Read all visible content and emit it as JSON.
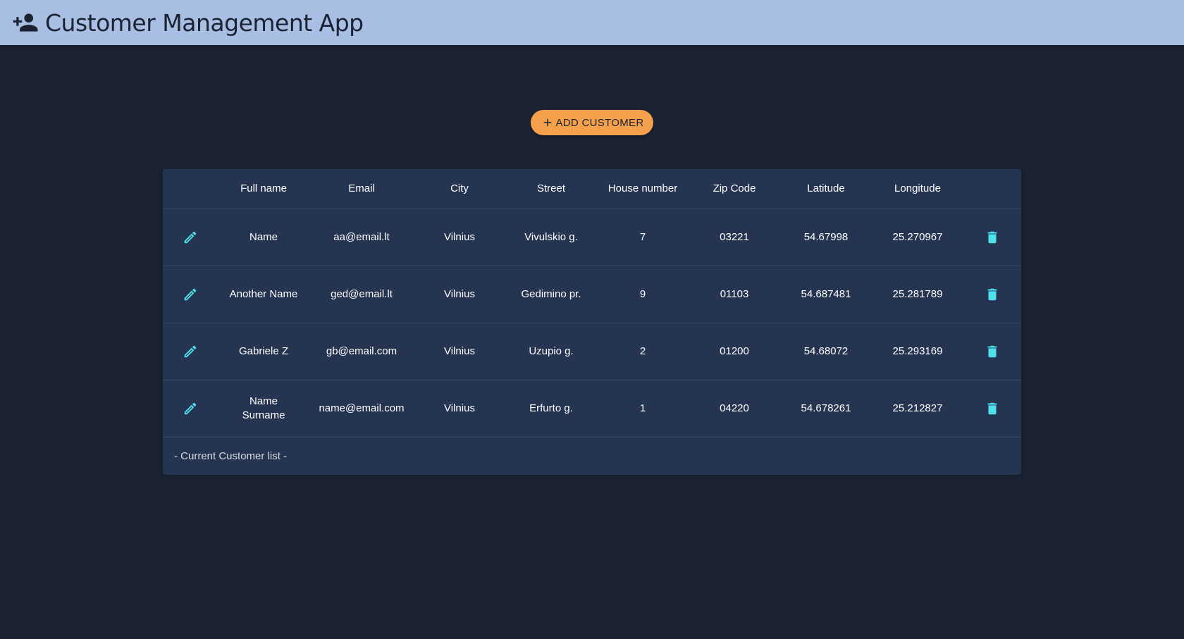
{
  "app": {
    "title": "Customer Management App",
    "logo_icon": "person-add-icon"
  },
  "colors": {
    "appbar": "#a8bee3",
    "background": "#1b2333",
    "table": "#243451",
    "accent_button": "#f5a04a",
    "icon": "#4fe0ee"
  },
  "actions": {
    "add_customer_label": "ADD CUSTOMER",
    "add_icon": "plus-icon",
    "edit_icon": "pencil-icon",
    "delete_icon": "trash-icon"
  },
  "table": {
    "headers": [
      "Full name",
      "Email",
      "City",
      "Street",
      "House number",
      "Zip Code",
      "Latitude",
      "Longitude"
    ],
    "rows": [
      {
        "full_name": "Name",
        "email": "aa@email.lt",
        "city": "Vilnius",
        "street": "Vivulskio g.",
        "house_number": "7",
        "zip_code": "03221",
        "latitude": "54.67998",
        "longitude": "25.270967"
      },
      {
        "full_name": "Another Name",
        "email": "ged@email.lt",
        "city": "Vilnius",
        "street": "Gedimino pr.",
        "house_number": "9",
        "zip_code": "01103",
        "latitude": "54.687481",
        "longitude": "25.281789"
      },
      {
        "full_name": "Gabriele Z",
        "email": "gb@email.com",
        "city": "Vilnius",
        "street": "Uzupio g.",
        "house_number": "2",
        "zip_code": "01200",
        "latitude": "54.68072",
        "longitude": "25.293169"
      },
      {
        "full_name": "Name Surname",
        "email": "name@email.com",
        "city": "Vilnius",
        "street": "Erfurto g.",
        "house_number": "1",
        "zip_code": "04220",
        "latitude": "54.678261",
        "longitude": "25.212827"
      }
    ],
    "caption": "- Current Customer list -"
  }
}
